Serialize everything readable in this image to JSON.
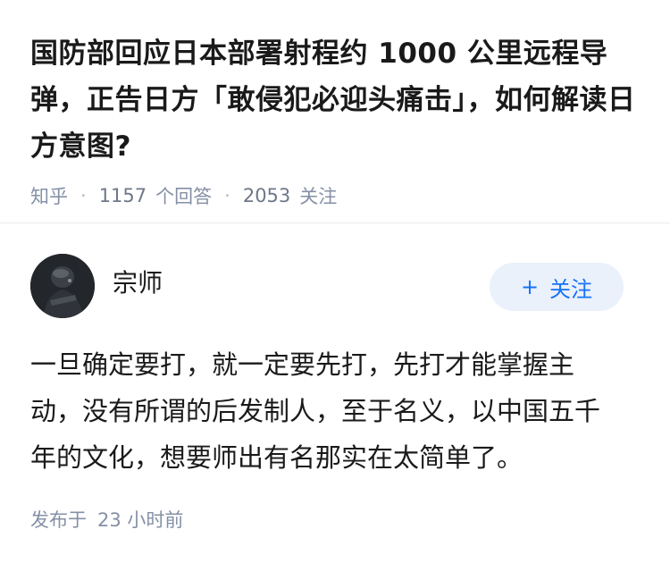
{
  "question": {
    "title": "国防部回应日本部署射程约 1000 公里远程导弹，正告日方「敢侵犯必迎头痛击」，如何解读日方意图?",
    "source": "知乎",
    "answers_count": "1157",
    "answers_label": "个回答",
    "follow_count": "2053",
    "follow_label": "关注",
    "separator": "·"
  },
  "answer": {
    "author_name": "宗师",
    "follow_button": {
      "plus": "+",
      "label": "关注"
    },
    "content": "一旦确定要打，就一定要先打，先打才能掌握主动，没有所谓的后发制人，至于名义，以中国五千年的文化，想要师出有名那实在太简单了。",
    "published_label": "发布于",
    "published_time": "23 小时前"
  },
  "colors": {
    "accent": "#1772f6",
    "follow_bg": "#eaf1fb",
    "meta_text": "#8590a6"
  }
}
